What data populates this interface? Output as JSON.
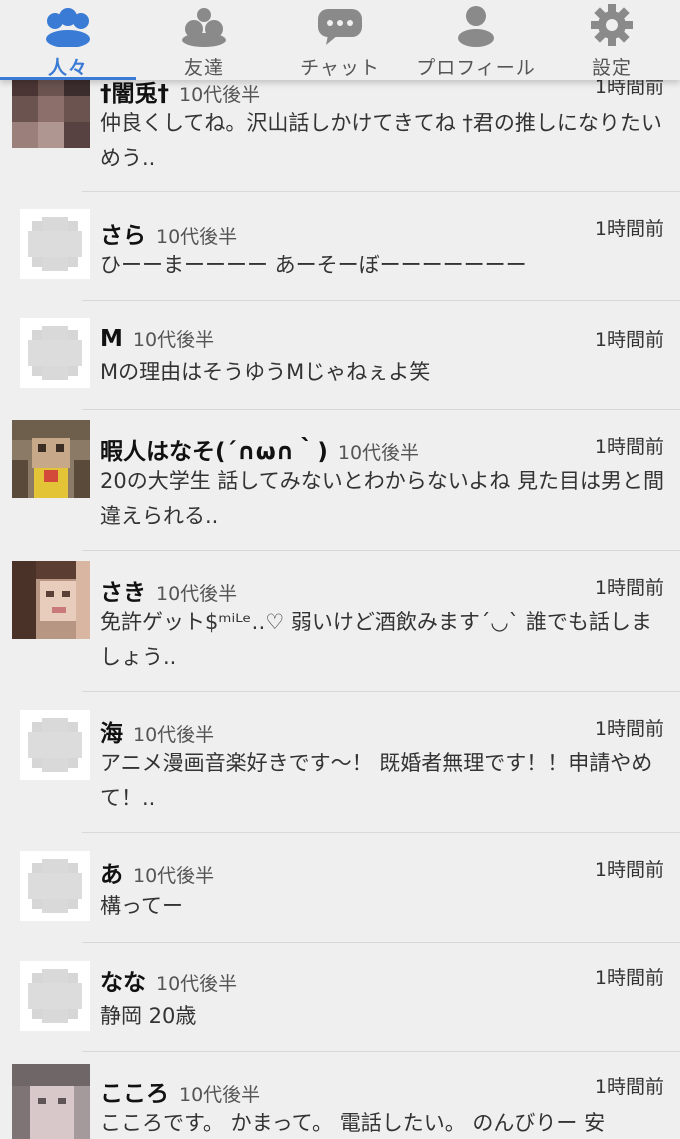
{
  "tabs": [
    {
      "label": "人々",
      "icon": "people-icon",
      "active": true
    },
    {
      "label": "友達",
      "icon": "friends-icon",
      "active": false
    },
    {
      "label": "チャット",
      "icon": "chat-icon",
      "active": false
    },
    {
      "label": "プロフィール",
      "icon": "profile-icon",
      "active": false
    },
    {
      "label": "設定",
      "icon": "gear-icon",
      "active": false
    }
  ],
  "colors": {
    "accent": "#3a7bd5",
    "icon_gray": "#8a8a8a"
  },
  "users": [
    {
      "name": "†闇兎†",
      "age": "10代後半",
      "time": "1時間前",
      "message": "仲良くしてね。沢山話しかけてきてね †君の推しになりたいめう.."
    },
    {
      "name": "さら",
      "age": "10代後半",
      "time": "1時間前",
      "message": "ひーーまーーーー あーそーぼーーーーーーー"
    },
    {
      "name": "M",
      "age": "10代後半",
      "time": "1時間前",
      "message": "Mの理由はそうゆうMじゃねぇよ笑"
    },
    {
      "name": "暇人はなそ(´∩ω∩｀)",
      "age": "10代後半",
      "time": "1時間前",
      "message": "20の大学生 話してみないとわからないよね 見た目は男と間違えられる.."
    },
    {
      "name": "さき",
      "age": "10代後半",
      "time": "1時間前",
      "message": "免許ゲット$ᵐⁱᴸᵉ‥♡ 弱いけど酒飲みます´◡` 誰でも話しましょう.."
    },
    {
      "name": "海",
      "age": "10代後半",
      "time": "1時間前",
      "message": "アニメ漫画音楽好きです〜！ 既婚者無理です！！申請やめて！.."
    },
    {
      "name": "あ",
      "age": "10代後半",
      "time": "1時間前",
      "message": "構ってー"
    },
    {
      "name": "なな",
      "age": "10代後半",
      "time": "1時間前",
      "message": "静岡 20歳"
    },
    {
      "name": "こころ",
      "age": "10代後半",
      "time": "1時間前",
      "message": "こころです。 かまって。 電話したい。 のんびりー 安"
    }
  ]
}
